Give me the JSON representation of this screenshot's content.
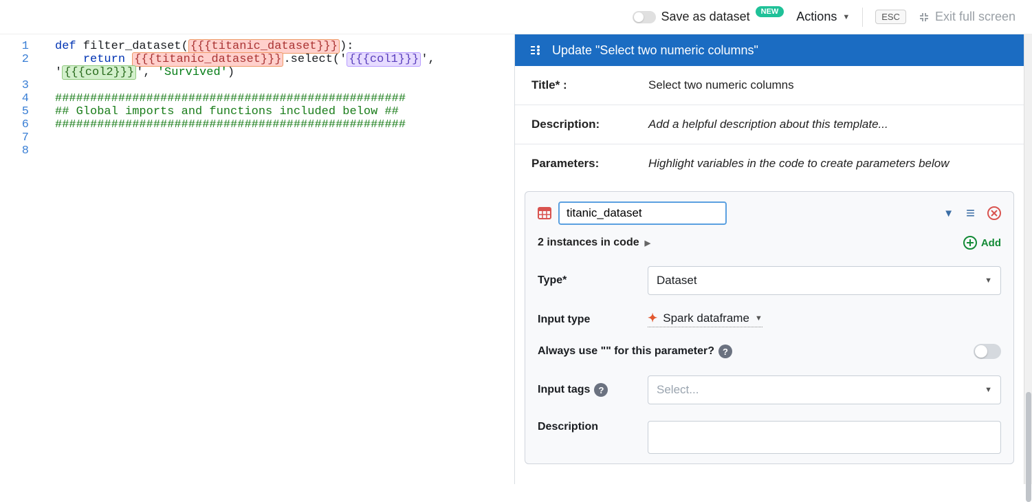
{
  "topbar": {
    "save_as_label": "Save as dataset",
    "new_badge": "NEW",
    "actions_label": "Actions",
    "esc_label": "ESC",
    "exit_label": "Exit full screen"
  },
  "editor": {
    "lines": [
      "1",
      "2",
      "3",
      "4",
      "5",
      "6",
      "7",
      "8"
    ],
    "kw_def": "def",
    "fn_name": " filter_dataset(",
    "titanic_token": "{{{titanic_dataset}}}",
    "def_tail": "):",
    "indent_return": "    ",
    "kw_return": "return",
    "space": " ",
    "select_open": ".select('",
    "col1_token": "{{{col1}}}",
    "select_mid": "', '",
    "col2_token": "{{{col2}}}",
    "select_tail_a": "', ",
    "survived": "'Survived'",
    "select_close": ")",
    "hashline": "##################################################",
    "comment_mid": "## Global imports and functions included below ##"
  },
  "panel": {
    "header": "Update \"Select two numeric columns\"",
    "title_label": "Title* :",
    "title_value": "Select two numeric columns",
    "desc_label": "Description:",
    "desc_placeholder": "Add a helpful description about this template...",
    "params_label": "Parameters:",
    "params_hint": "Highlight variables in the code to create parameters below"
  },
  "param": {
    "name": "titanic_dataset",
    "instances_label": "2 instances in code",
    "add_label": "Add",
    "type_label": "Type*",
    "type_value": "Dataset",
    "input_type_label": "Input type",
    "input_type_value": "Spark dataframe",
    "always_use_label": "Always use \"\" for this parameter?",
    "input_tags_label": "Input tags",
    "input_tags_placeholder": "Select...",
    "desc_label": "Description"
  }
}
